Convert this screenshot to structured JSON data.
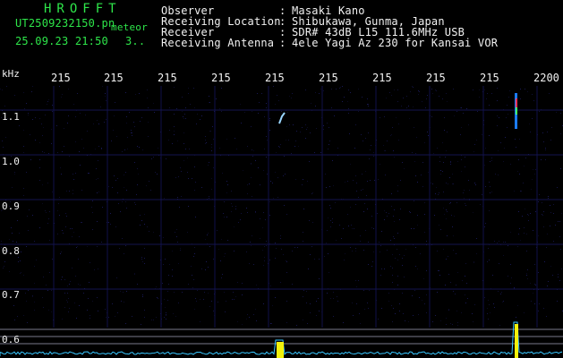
{
  "header": {
    "brand": "HROFFT",
    "filename": "UT2509232150.pn",
    "kind": "meteor",
    "datetime": "25.09.23 21:50",
    "counter": "3..",
    "meta": [
      {
        "label": "Observer",
        "sep": ":",
        "value": "Masaki Kano"
      },
      {
        "label": "Receiving Location",
        "sep": ":",
        "value": "Shibukawa, Gunma, Japan"
      },
      {
        "label": "Receiver",
        "sep": ":",
        "value": "SDR# 43dB L15 111.6MHz USB"
      },
      {
        "label": "Receiving Antenna",
        "sep": ":",
        "value": "4ele Yagi Az 230 for Kansai VOR"
      }
    ]
  },
  "axis": {
    "unit": "kHz",
    "time_ticks": [
      "215",
      "215",
      "215",
      "215",
      "215",
      "215",
      "215",
      "215",
      "215",
      "2200"
    ],
    "freq_ticks": [
      "1.1",
      "1.0",
      "0.9",
      "0.8",
      "0.7",
      "0.6"
    ]
  },
  "colors": {
    "label_green": "#2ee64a",
    "text_white": "#f2f2f2",
    "background": "#000000",
    "noise": "#0c0c3a"
  }
}
